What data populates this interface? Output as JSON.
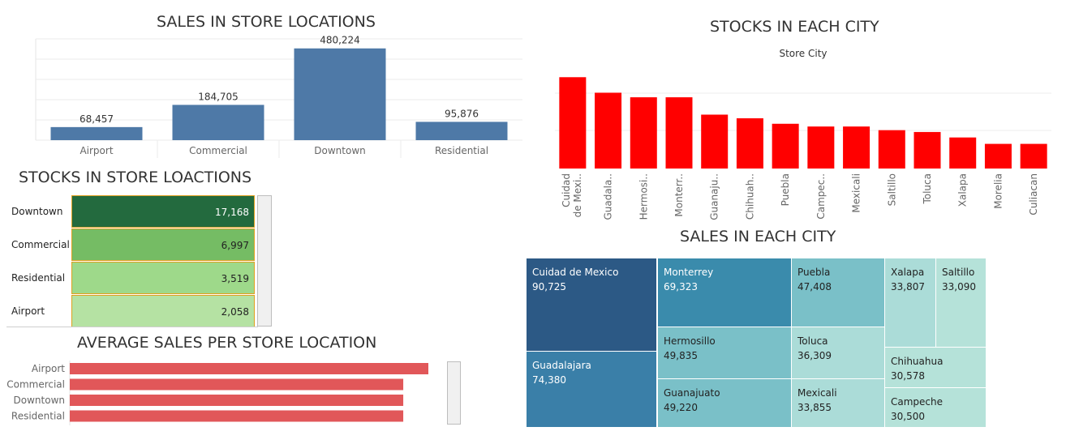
{
  "titles": {
    "sales_store_locations": "SALES IN STORE LOCATIONS",
    "stocks_each_city": "STOCKS IN EACH CITY",
    "stocks_store_locations": "STOCKS IN STORE LOACTIONS",
    "sales_each_city": "SALES IN EACH CITY",
    "avg_sales_store_location": "AVERAGE SALES PER STORE LOCATION"
  },
  "colors": {
    "steel_blue": "#4e79a7",
    "red": "#ff0000",
    "avg_bar": "#e15759",
    "green_dark": "#1e6b3c",
    "green_mid": "#74bd63",
    "green_light": "#9cd987",
    "green_pale": "#b4e2a2"
  },
  "stock_table": {
    "rows": [
      {
        "label": "Downtown",
        "value": "17,168",
        "color": "#236a3e",
        "text_color": "#ffffff"
      },
      {
        "label": "Commercial",
        "value": "6,997",
        "color": "#75bc64",
        "text_color": "#222222"
      },
      {
        "label": "Residential",
        "value": "3,519",
        "color": "#9ed98a",
        "text_color": "#222222"
      },
      {
        "label": "Airport",
        "value": "2,058",
        "color": "#b5e2a3",
        "text_color": "#222222"
      }
    ]
  },
  "treemap": {
    "cells": [
      {
        "name": "Cuidad de Mexico",
        "value": "90,725",
        "color": "#2c5985",
        "text": "#ffffff"
      },
      {
        "name": "Guadalajara",
        "value": "74,380",
        "color": "#3a7fa8",
        "text": "#ffffff"
      },
      {
        "name": "Monterrey",
        "value": "69,323",
        "color": "#3a8bac",
        "text": "#ffffff"
      },
      {
        "name": "Hermosillo",
        "value": "49,835",
        "color": "#7ac0c8",
        "text": "#222222"
      },
      {
        "name": "Guanajuato",
        "value": "49,220",
        "color": "#7ac0c8",
        "text": "#222222"
      },
      {
        "name": "Puebla",
        "value": "47,408",
        "color": "#7ac0c8",
        "text": "#222222"
      },
      {
        "name": "Toluca",
        "value": "36,309",
        "color": "#abdcd8",
        "text": "#222222"
      },
      {
        "name": "Mexicali",
        "value": "33,855",
        "color": "#abdcd8",
        "text": "#222222"
      },
      {
        "name": "Xalapa",
        "value": "33,807",
        "color": "#abdcd8",
        "text": "#222222"
      },
      {
        "name": "Saltillo",
        "value": "33,090",
        "color": "#b5e2d9",
        "text": "#222222"
      },
      {
        "name": "Chihuahua",
        "value": "30,578",
        "color": "#b5e2d9",
        "text": "#222222"
      },
      {
        "name": "Campeche",
        "value": "30,500",
        "color": "#b5e2d9",
        "text": "#222222"
      }
    ]
  },
  "chart_data": [
    {
      "type": "bar",
      "title": "SALES IN STORE LOCATIONS",
      "categories": [
        "Airport",
        "Commercial",
        "Downtown",
        "Residential"
      ],
      "values": [
        68457,
        184705,
        480224,
        95876
      ],
      "value_labels": [
        "68,457",
        "184,705",
        "480,224",
        "95,876"
      ],
      "ylim": [
        0,
        530000
      ],
      "grid": true
    },
    {
      "type": "bar",
      "title": "STOCKS IN EACH CITY",
      "subtitle": "Store City",
      "categories": [
        "Cuidad de Mexi..",
        "Guadala..",
        "Hermosi..",
        "Monterr..",
        "Guanaju..",
        "Chihuah..",
        "Puebla",
        "Campec..",
        "Mexicali",
        "Saltillo",
        "Toluca",
        "Xalapa",
        "Morelia",
        "Culiacan"
      ],
      "values": [
        100,
        83,
        78,
        78,
        59,
        55,
        49,
        46,
        46,
        42,
        40,
        34,
        27,
        27
      ],
      "ylim": [
        0,
        110
      ],
      "grid": true
    },
    {
      "type": "bar",
      "orientation": "horizontal",
      "title": "AVERAGE SALES PER STORE LOCATION",
      "categories": [
        "Airport",
        "Commercial",
        "Downtown",
        "Residential"
      ],
      "values": [
        100,
        93,
        93,
        93
      ],
      "xlim": [
        0,
        100
      ]
    },
    {
      "type": "table",
      "title": "STOCKS IN STORE LOACTIONS",
      "categories": [
        "Downtown",
        "Commercial",
        "Residential",
        "Airport"
      ],
      "values": [
        17168,
        6997,
        3519,
        2058
      ]
    },
    {
      "type": "heatmap",
      "title": "SALES IN EACH CITY",
      "categories": [
        "Cuidad de Mexico",
        "Guadalajara",
        "Monterrey",
        "Hermosillo",
        "Guanajuato",
        "Puebla",
        "Toluca",
        "Mexicali",
        "Xalapa",
        "Saltillo",
        "Chihuahua",
        "Campeche"
      ],
      "values": [
        90725,
        74380,
        69323,
        49835,
        49220,
        47408,
        36309,
        33855,
        33807,
        33090,
        30578,
        30500
      ]
    }
  ]
}
